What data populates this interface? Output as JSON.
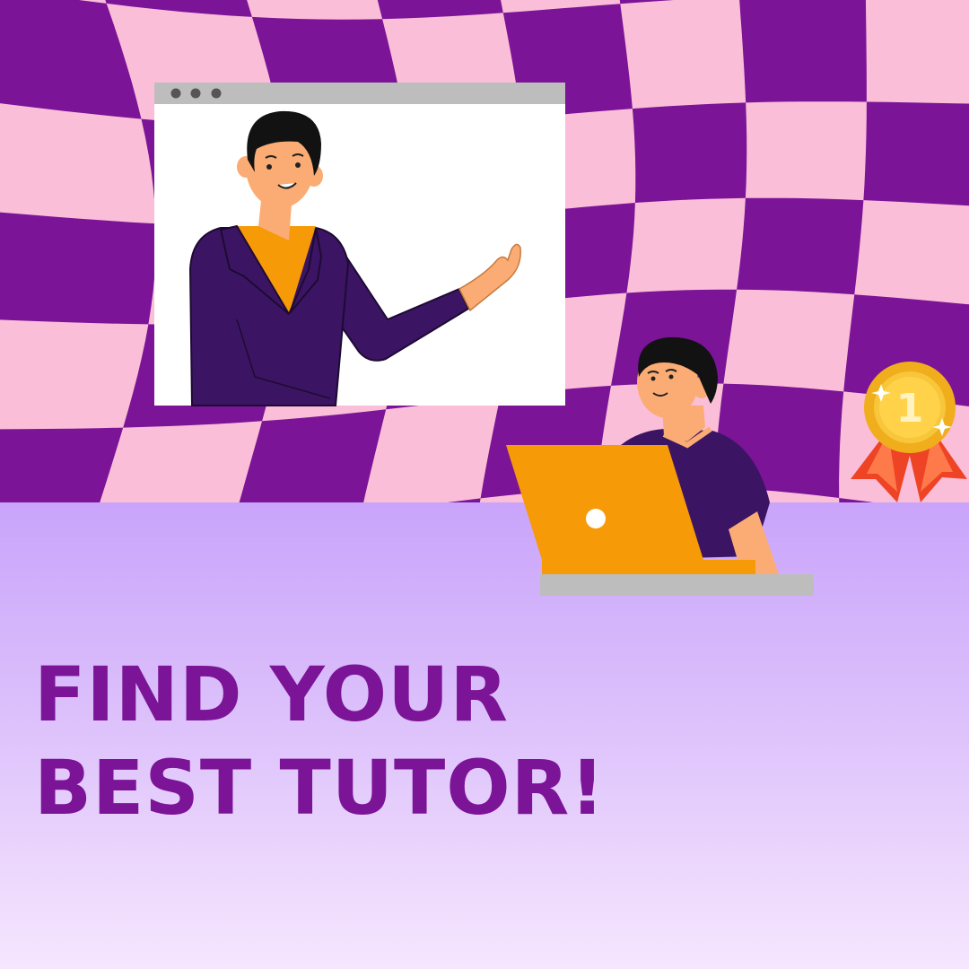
{
  "headline": {
    "line1": "FIND YOUR",
    "line2": "BEST TUTOR!"
  },
  "badge": {
    "label": "1"
  },
  "colors": {
    "checker_purple": "#7b1497",
    "checker_pink": "#fbbed9",
    "floor_top": "#c9a4fb",
    "floor_bottom": "#f6e6fe",
    "headline": "#7b1497",
    "accent_orange": "#f79a07",
    "suit_purple": "#3b1563",
    "skin": "#fbac74",
    "medal_gold": "#f0ad1c",
    "ribbon_red": "#ee4425"
  },
  "icons": [
    "window-dots-icon",
    "laptop-logo-icon",
    "medal-icon",
    "sparkle-icon"
  ]
}
